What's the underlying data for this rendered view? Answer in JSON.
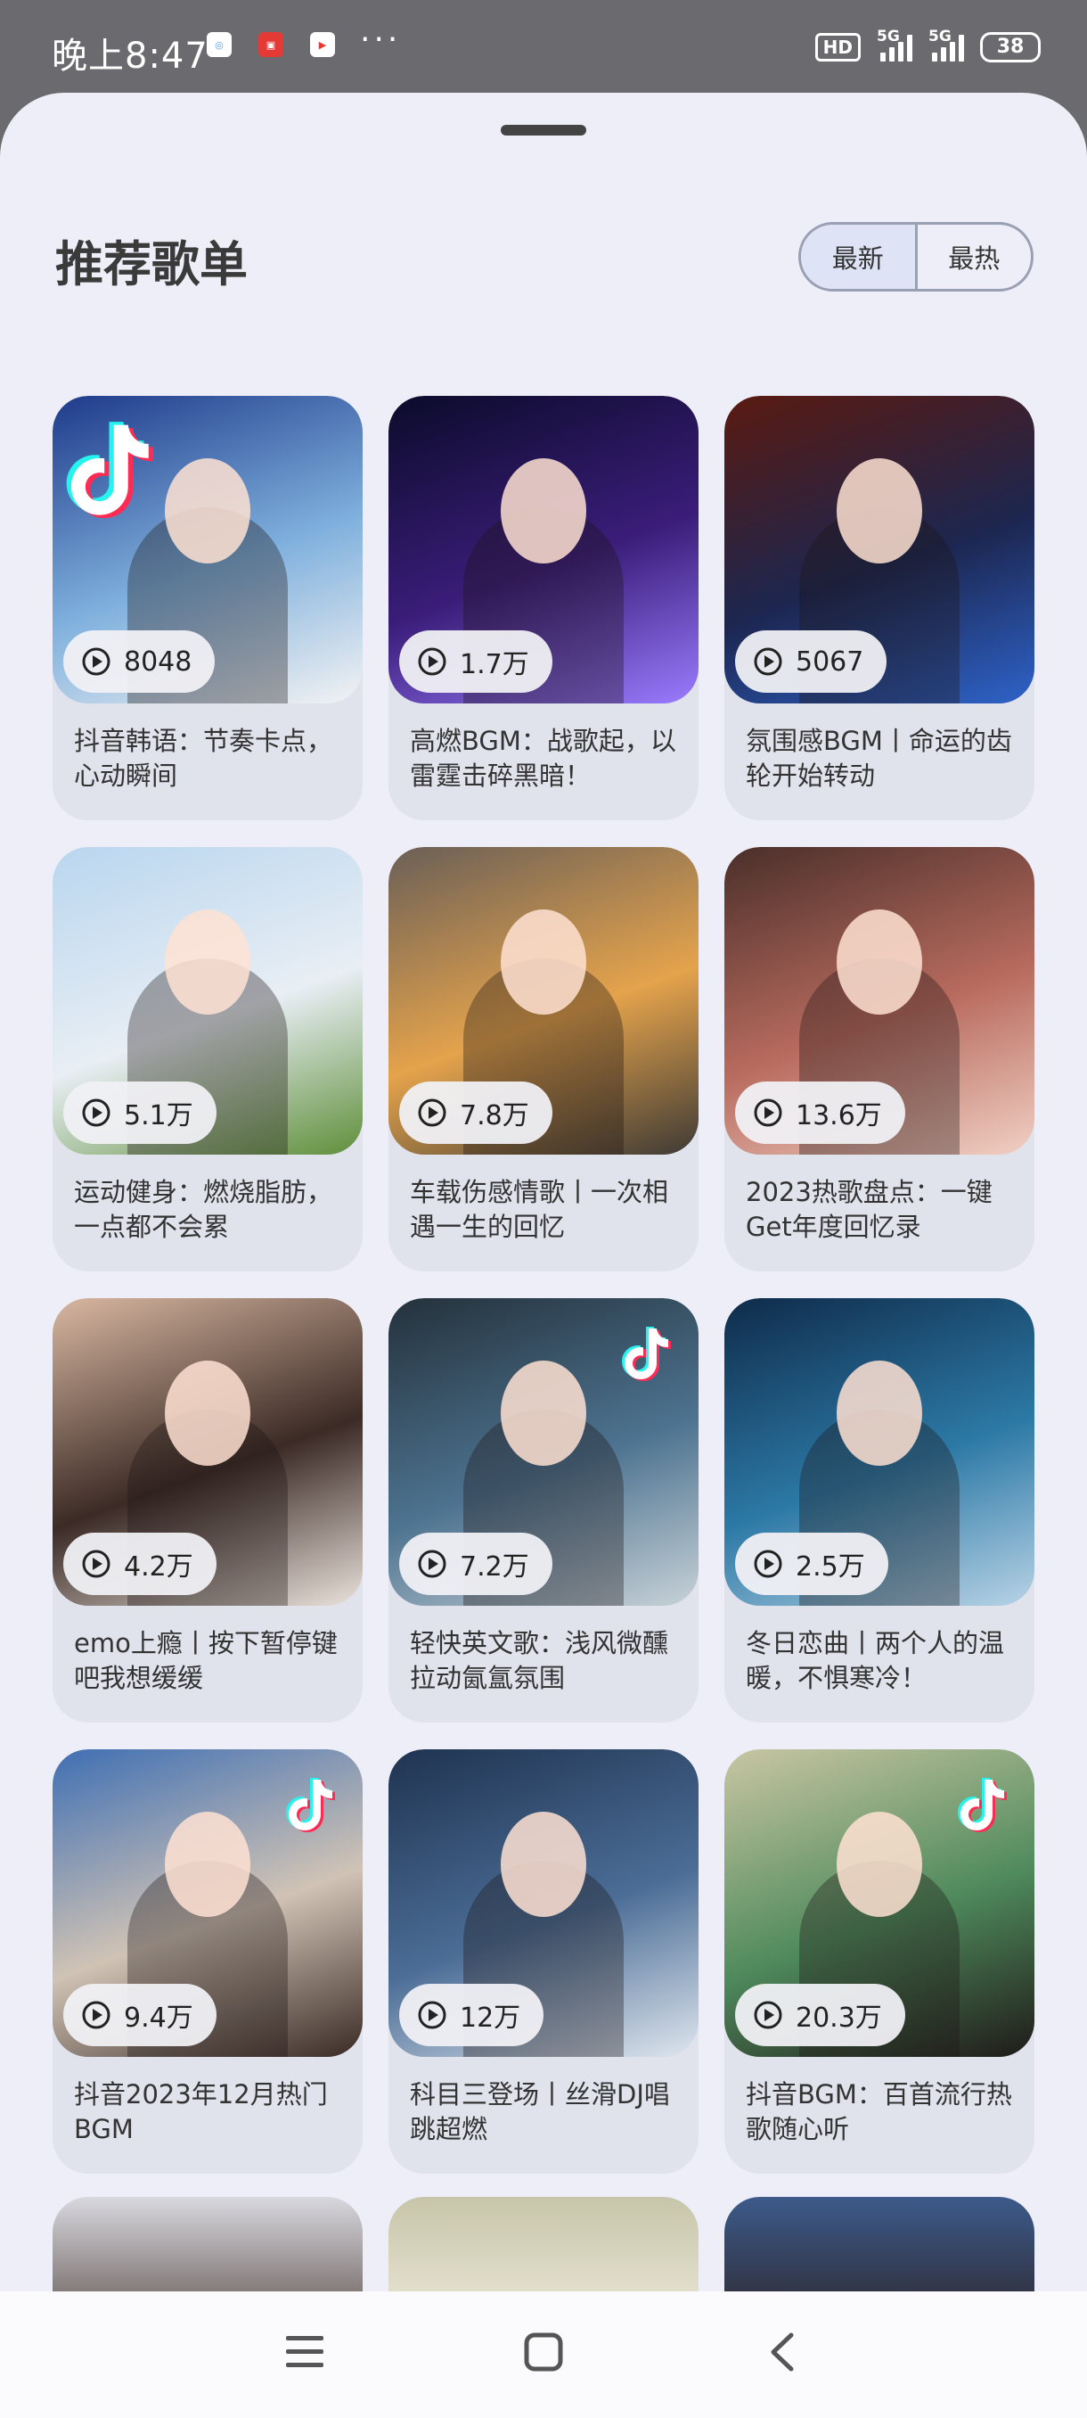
{
  "status_bar": {
    "time": "晚上8:47",
    "app_icons": [
      "app-notification-icon",
      "tmall-icon",
      "video-app-icon"
    ],
    "more": "···",
    "hd_badge": "HD",
    "signal_1": "5G",
    "signal_2": "5G",
    "battery": "38"
  },
  "header": {
    "title": "推荐歌单",
    "segment": {
      "options": [
        "最新",
        "最热"
      ],
      "selected": "最新"
    }
  },
  "playlists": [
    {
      "title": "抖音韩语：节奏卡点，心动瞬间",
      "plays": "8048",
      "colors": [
        "#1e3a8a",
        "#7fb0dd",
        "#f3f3f3"
      ]
    },
    {
      "title": "高燃BGM：战歌起，以雷霆击碎黑暗！",
      "plays": "1.7万",
      "colors": [
        "#0b0b2a",
        "#3b1d7a",
        "#9a7cff"
      ]
    },
    {
      "title": "氛围感BGM丨命运的齿轮开始转动",
      "plays": "5067",
      "colors": [
        "#5a1a10",
        "#1c2650",
        "#2e63c9"
      ]
    },
    {
      "title": "运动健身：燃烧脂肪，一点都不会累",
      "plays": "5.1万",
      "colors": [
        "#b9d6ef",
        "#e8eef4",
        "#5f8f3a"
      ]
    },
    {
      "title": "车载伤感情歌丨一次相遇一生的回忆",
      "plays": "7.8万",
      "colors": [
        "#6a5f57",
        "#e4a34c",
        "#3e3a35"
      ]
    },
    {
      "title": "2023热歌盘点：一键Get年度回忆录",
      "plays": "13.6万",
      "colors": [
        "#4a2f2a",
        "#b86b5e",
        "#f1d0c4"
      ]
    },
    {
      "title": "emo上瘾丨按下暂停键吧我想缓缓",
      "plays": "4.2万",
      "colors": [
        "#d9b8a2",
        "#3b2a25",
        "#eae2dc"
      ]
    },
    {
      "title": "轻快英文歌：浅风微醺拉动氤氲氛围",
      "plays": "7.2万",
      "colors": [
        "#24313b",
        "#4d7390",
        "#c8d2d8"
      ]
    },
    {
      "title": "冬日恋曲丨两个人的温暖，不惧寒冷！",
      "plays": "2.5万",
      "colors": [
        "#0f2b4a",
        "#2c79a6",
        "#b8d3e6"
      ]
    },
    {
      "title": "抖音2023年12月热门BGM",
      "plays": "9.4万",
      "colors": [
        "#3f6fb3",
        "#d0c3b5",
        "#3a2a25"
      ]
    },
    {
      "title": "科目三登场丨丝滑DJ唱跳超燃",
      "plays": "12万",
      "colors": [
        "#1f3350",
        "#4b6d96",
        "#dfe6ee"
      ]
    },
    {
      "title": "抖音BGM：百首流行热歌随心听",
      "plays": "20.3万",
      "colors": [
        "#c9c6a3",
        "#4f8a5c",
        "#1f1a18"
      ]
    }
  ],
  "partial_row": [
    {
      "colors": [
        "#d8d8de",
        "#4a3a35"
      ]
    },
    {
      "colors": [
        "#c7c5a9",
        "#f4efe4"
      ]
    },
    {
      "colors": [
        "#3c5a8a",
        "#2a1c1a"
      ]
    }
  ],
  "tiktok_badges": [
    0,
    7,
    9,
    11
  ],
  "nav": [
    "menu-icon",
    "home-icon",
    "back-icon"
  ]
}
